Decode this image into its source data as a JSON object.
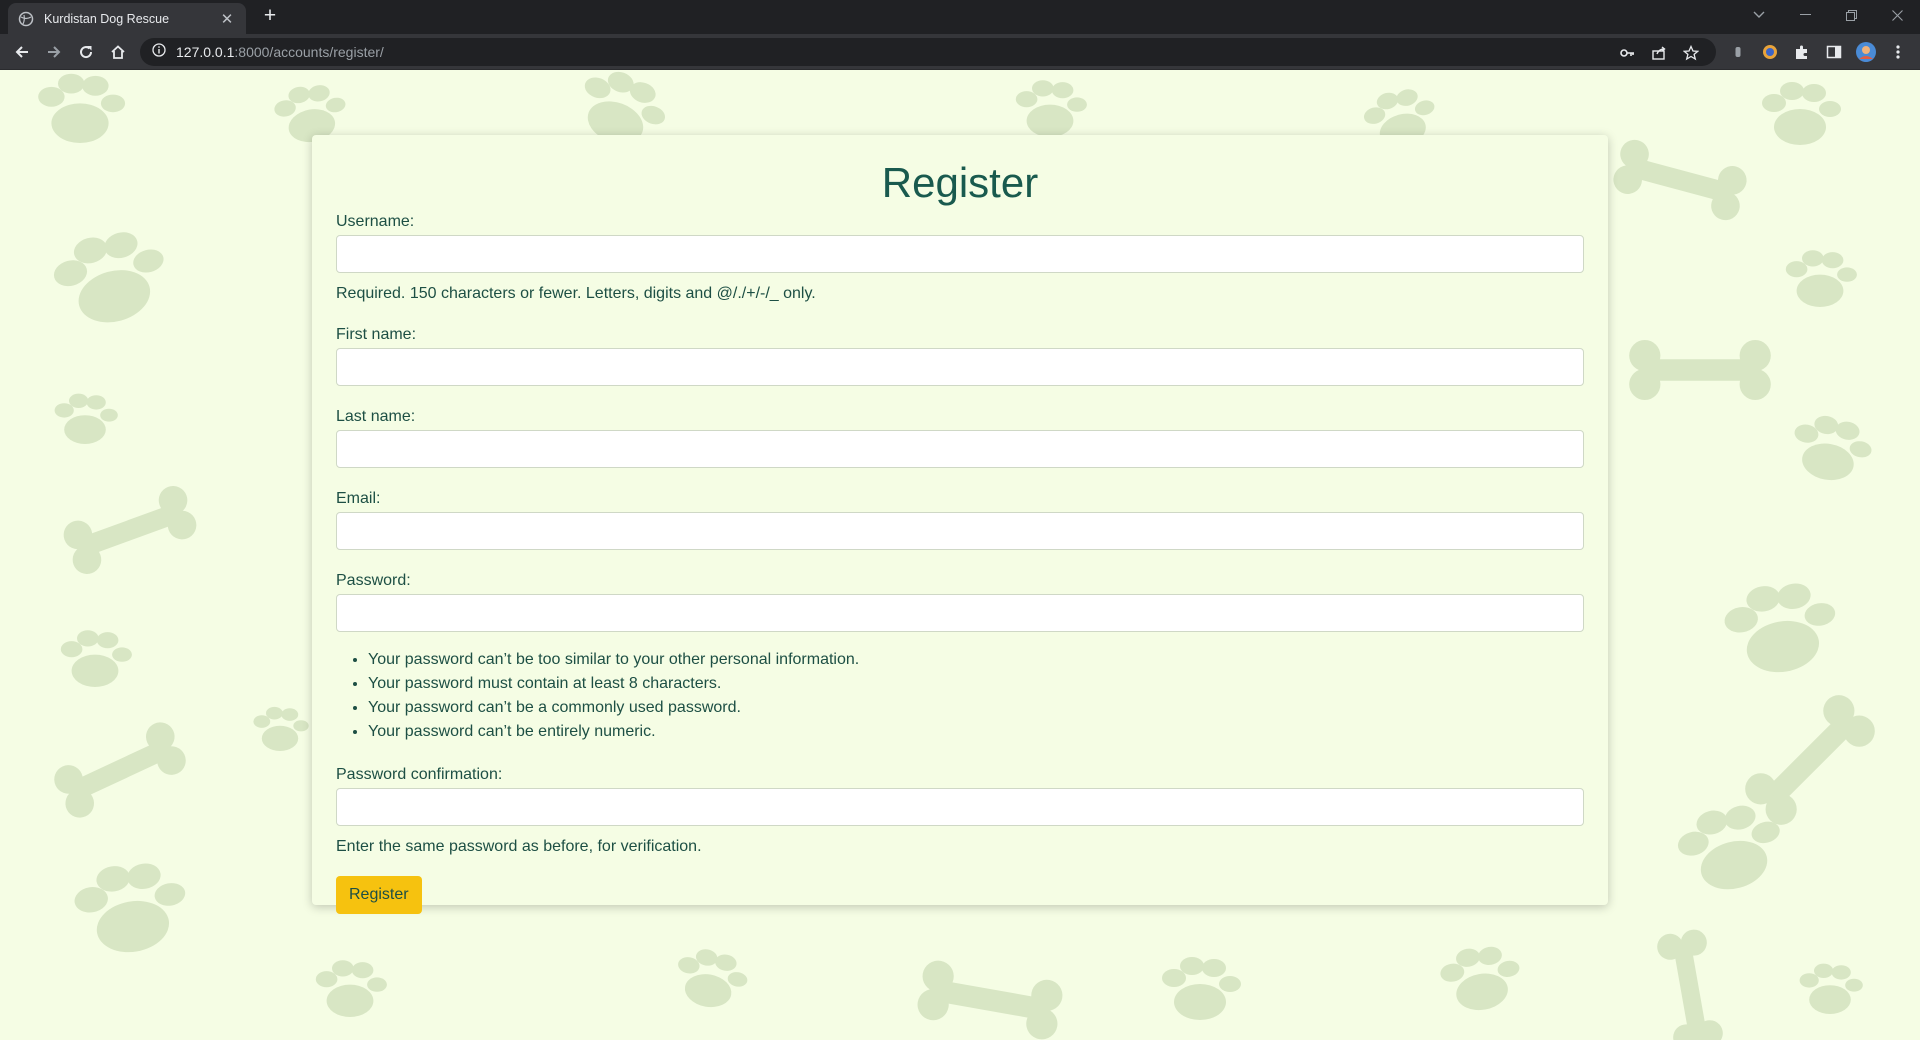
{
  "browser": {
    "tab_title": "Kurdistan Dog Rescue",
    "tab_close": "✕",
    "new_tab": "+",
    "url_host": "127.0.0.1",
    "url_rest": ":8000/accounts/register/"
  },
  "form": {
    "title": "Register",
    "fields": [
      {
        "label": "Username:",
        "value": "",
        "help": "Required. 150 characters or fewer. Letters, digits and @/./+/-/_ only."
      },
      {
        "label": "First name:",
        "value": ""
      },
      {
        "label": "Last name:",
        "value": ""
      },
      {
        "label": "Email:",
        "value": ""
      },
      {
        "label": "Password:",
        "value": ""
      },
      {
        "label": "Password confirmation:",
        "value": "",
        "help": "Enter the same password as before, for verification."
      }
    ],
    "password_rules": [
      "Your password can’t be too similar to your other personal information.",
      "Your password must contain at least 8 characters.",
      "Your password can’t be a commonly used password.",
      "Your password can’t be entirely numeric."
    ],
    "submit_label": "Register"
  },
  "colors": {
    "page_bg": "#f5fde4",
    "paw_print": "#d8e6c4",
    "heading": "#195a4e",
    "button": "#f6c20f"
  },
  "decor": {
    "background_pattern": "paw-print-and-bone"
  }
}
